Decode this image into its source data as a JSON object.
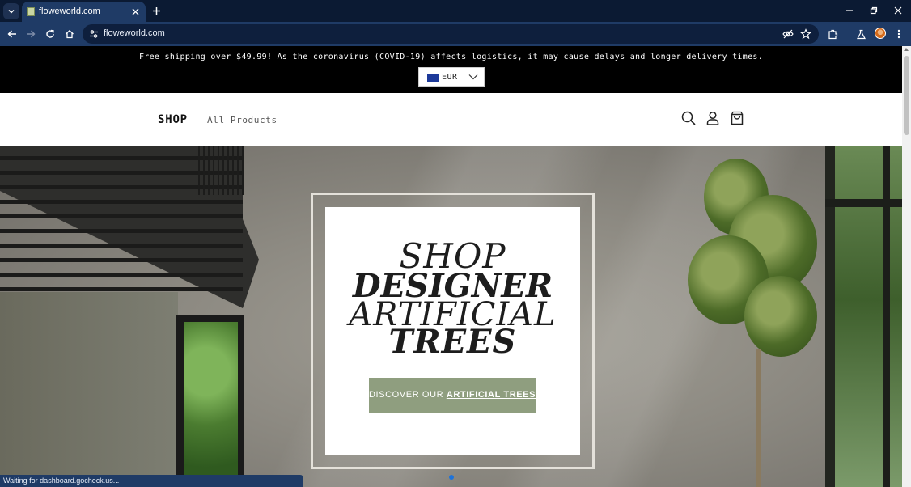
{
  "browser": {
    "tab_title": "floweworld.com",
    "url": "floweworld.com",
    "status_text": "Waiting for dashboard.gocheck.us..."
  },
  "announcement": {
    "text": "Free shipping over $49.99! As the coronavirus (COVID-19) affects logistics, it may cause delays and longer delivery times.",
    "currency": "EUR"
  },
  "header": {
    "logo": "SHOP",
    "nav_link": "All Products",
    "icons": [
      "search-icon",
      "account-icon",
      "cart-icon"
    ]
  },
  "hero": {
    "headline": [
      "SHOP",
      "DESIGNER",
      "ARTIFICIAL",
      "TREES"
    ],
    "cta_prefix": "DISCOVER OUR ",
    "cta_strong": "ARTIFICIAL TREES",
    "slide_dots": 1
  },
  "colors": {
    "chrome_dark": "#0b1a33",
    "chrome": "#1f3b66",
    "cta_bg": "#8f9e7f",
    "dot_active": "#1e73d9"
  }
}
